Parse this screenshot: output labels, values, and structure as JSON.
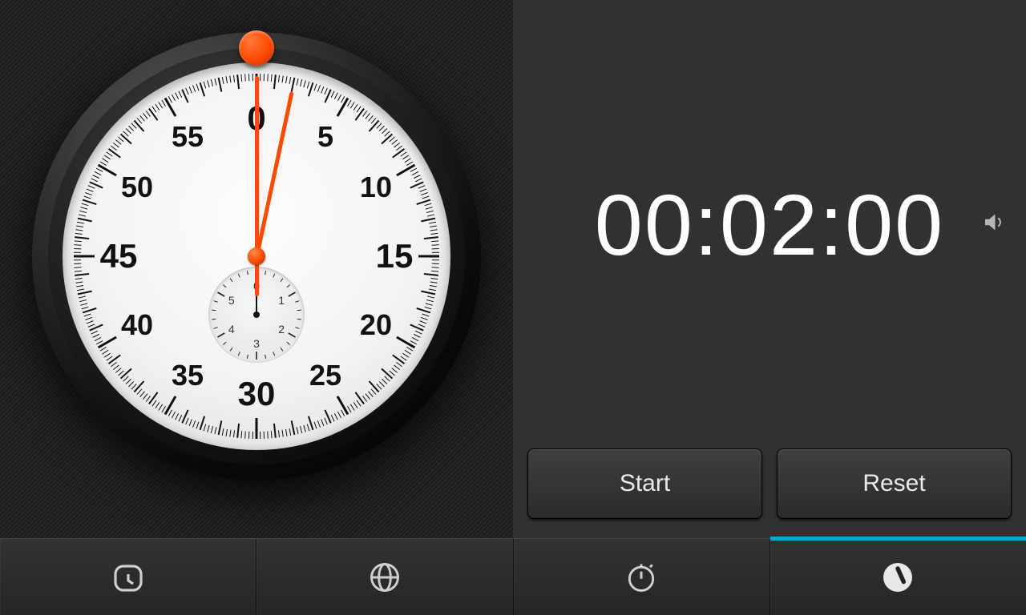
{
  "timer": {
    "display": "00:02:00",
    "hours": 0,
    "minutes": 2,
    "seconds": 0,
    "sound_on": true
  },
  "buttons": {
    "start": "Start",
    "reset": "Reset"
  },
  "stopwatch_dial": {
    "big_numerals": [
      "0",
      "5",
      "10",
      "15",
      "20",
      "25",
      "30",
      "35",
      "40",
      "45",
      "50",
      "55"
    ],
    "sub_numerals": [
      "0",
      "1",
      "2",
      "3",
      "4",
      "5"
    ],
    "second_hand_angle": 0,
    "minute_hand_angle": 12,
    "sub_hand_angle": 0
  },
  "tabs": {
    "items": [
      {
        "name": "alarm",
        "active": false
      },
      {
        "name": "world",
        "active": false
      },
      {
        "name": "stopwatch",
        "active": false
      },
      {
        "name": "timer",
        "active": true
      }
    ]
  },
  "colors": {
    "accent": "#00a9d6",
    "hand": "#ff4a00",
    "panel": "#313131"
  }
}
